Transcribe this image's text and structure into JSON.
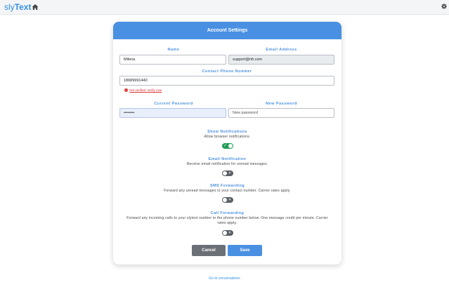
{
  "app": {
    "brand_light": "sly",
    "brand_bold": "Text"
  },
  "card": {
    "title": "Account Settings"
  },
  "fields": {
    "name_label": "Name",
    "name_value": "Milena",
    "email_label": "Email Address",
    "email_value": "support@nfr.com",
    "phone_label": "Contact Phone Number",
    "phone_value": "18689991440",
    "phone_error_prefix": "Not verified.",
    "phone_error_link": "Verify now",
    "current_password_label": "Current Password",
    "current_password_value": "••••••••",
    "new_password_label": "New Password",
    "new_password_placeholder": "New password"
  },
  "settings": [
    {
      "title": "Show Notifications",
      "description": "Allow browser notifications.",
      "enabled": true
    },
    {
      "title": "Email Notification",
      "description": "Receive email notification for unread messages.",
      "enabled": false
    },
    {
      "title": "SMS Forwarding",
      "description": "Forward any unread messages to your contact number. Carrier rates apply.",
      "enabled": false
    },
    {
      "title": "Call Forwarding",
      "description": "Forward any incoming calls to your slytext number to the phone number below. One message credit per minute. Carrier rates apply.",
      "enabled": false
    }
  ],
  "buttons": {
    "cancel": "Cancel",
    "save": "Save"
  },
  "footer": {
    "link": "Go to conversations"
  },
  "colors": {
    "accent": "#4a90e2",
    "success": "#1f9d55",
    "danger": "#d9302c"
  },
  "icons": {
    "home": "home-icon",
    "settings": "gear-icon",
    "error": "error-icon"
  }
}
